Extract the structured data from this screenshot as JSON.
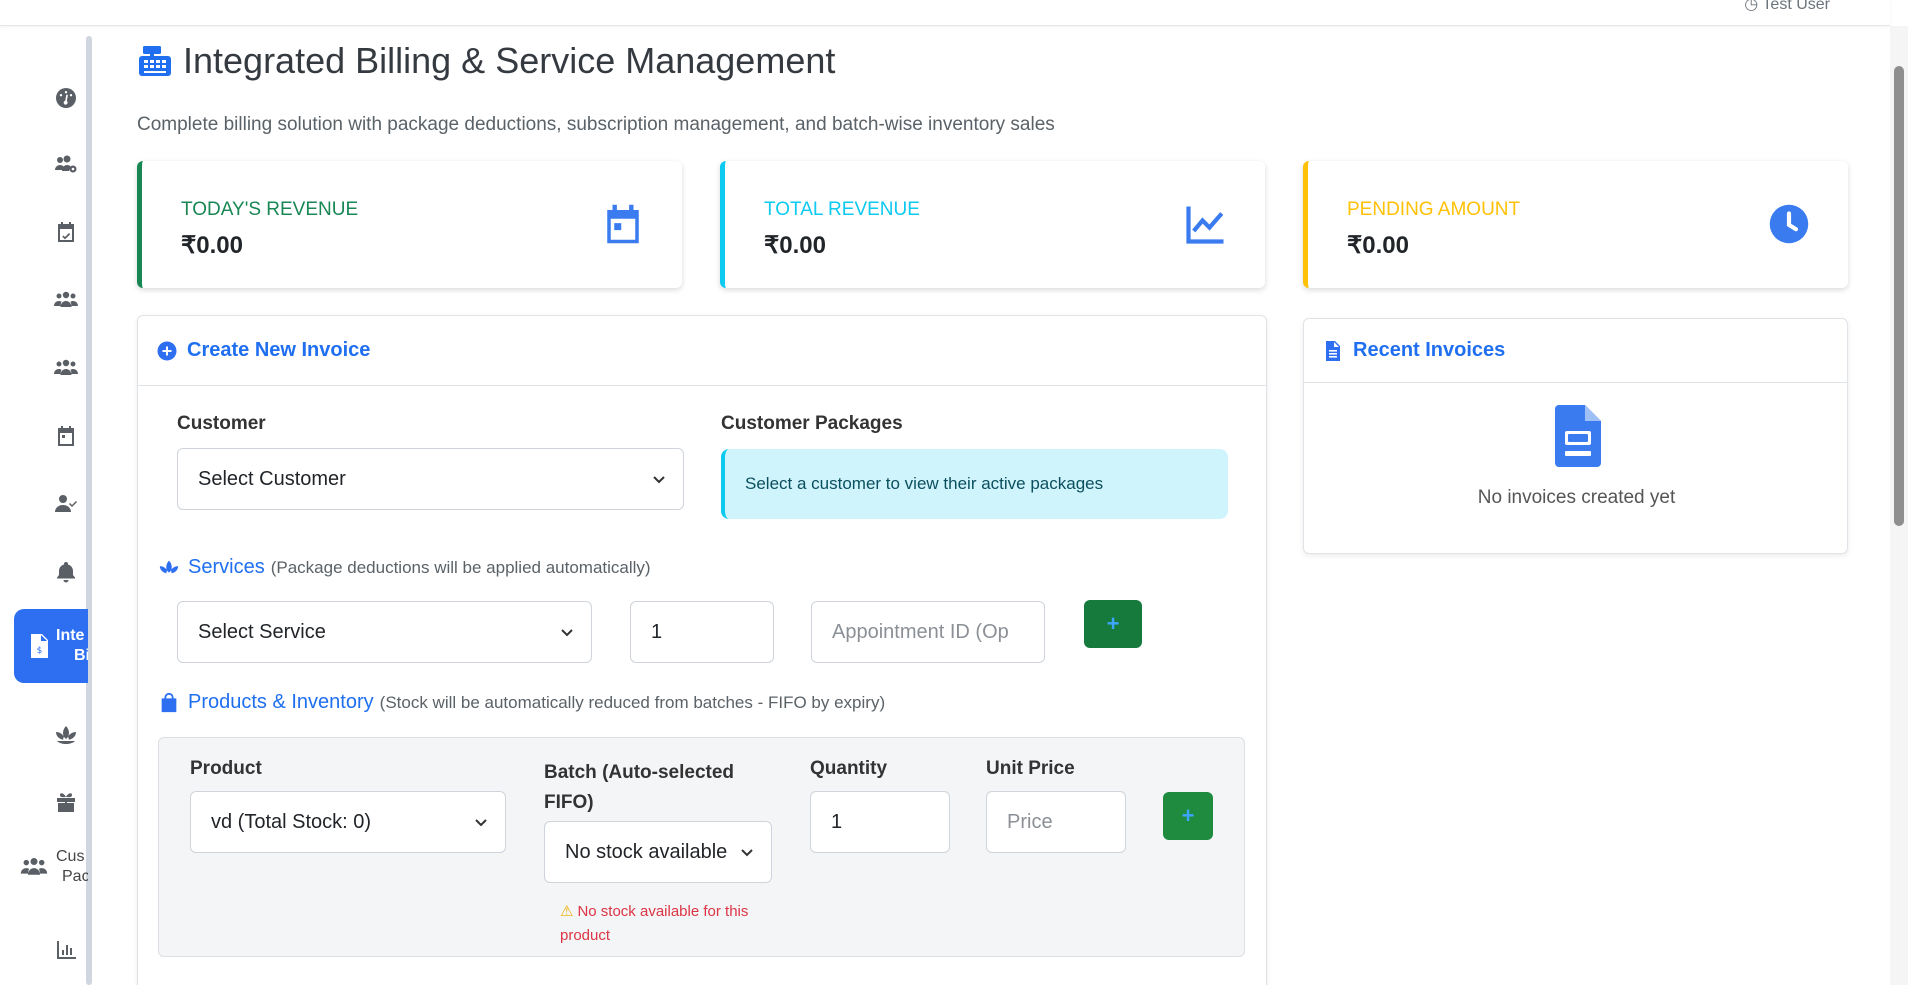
{
  "topbar": {
    "user_name": "Test User"
  },
  "sidebar": {
    "items": [
      {
        "icon": "dashboard-icon"
      },
      {
        "icon": "users-cog-icon"
      },
      {
        "icon": "calendar-check-icon"
      },
      {
        "icon": "users-icon"
      },
      {
        "icon": "users-icon"
      },
      {
        "icon": "calendar-icon"
      },
      {
        "icon": "user-check-icon"
      },
      {
        "icon": "bell-icon"
      },
      {
        "icon": "invoice-dollar-icon",
        "label_line1": "Inte",
        "label_line2": "Bi",
        "active": true
      },
      {
        "icon": "spa-icon"
      },
      {
        "icon": "gift-icon"
      },
      {
        "icon": "users-icon",
        "label_line1": "Cus",
        "label_line2": "Pac"
      },
      {
        "icon": "chart-bar-icon"
      }
    ]
  },
  "page": {
    "title": "Integrated Billing & Service Management",
    "subtitle": "Complete billing solution with package deductions, subscription management, and batch-wise inventory sales"
  },
  "stats": [
    {
      "label": "TODAY'S REVENUE",
      "value": "₹0.00",
      "color": "#198754",
      "icon": "calendar-icon"
    },
    {
      "label": "TOTAL REVENUE",
      "value": "₹0.00",
      "color": "#0dcaf0",
      "icon": "chart-line-icon"
    },
    {
      "label": "PENDING AMOUNT",
      "value": "₹0.00",
      "color": "#ffc107",
      "icon": "clock-icon"
    }
  ],
  "invoice": {
    "title": "Create New Invoice",
    "customer_label": "Customer",
    "customer_value": "Select Customer",
    "packages_label": "Customer Packages",
    "packages_info": "Select a customer to view their active packages",
    "services_title": "Services",
    "services_note": "(Package deductions will be applied automatically)",
    "service_value": "Select Service",
    "service_qty": "1",
    "appointment_placeholder": "Appointment ID (Op",
    "products_title": "Products & Inventory",
    "products_note": "(Stock will be automatically reduced from batches - FIFO by expiry)",
    "product_label": "Product",
    "product_value": "vd (Total Stock: 0)",
    "batch_label": "Batch (Auto-selected FIFO)",
    "batch_value": "No stock available",
    "quantity_label": "Quantity",
    "quantity_value": "1",
    "price_label": "Unit Price",
    "price_placeholder": "Price",
    "stock_warning": "No stock available for this product",
    "add_symbol": "+"
  },
  "recent": {
    "title": "Recent Invoices",
    "empty_text": "No invoices created yet"
  }
}
